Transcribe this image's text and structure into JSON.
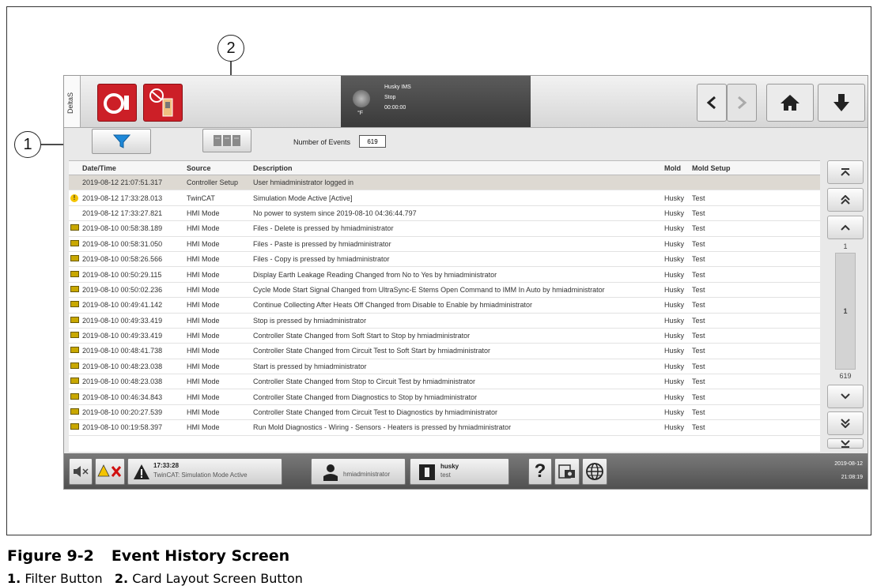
{
  "callouts": {
    "one": "1",
    "two": "2"
  },
  "header": {
    "side_tab": "DeltaS",
    "status_lines": [
      "Husky IMS",
      "Stop",
      "00:00:00"
    ],
    "temp_unit": "°F"
  },
  "toolbar": {
    "events_label": "Number of Events",
    "events_count": "619"
  },
  "table": {
    "columns": [
      "Date/Time",
      "Source",
      "Description",
      "Mold",
      "Mold Setup"
    ],
    "rows": [
      {
        "icon": "none",
        "dt": "2019-08-12 21:07:51.317",
        "src": "Controller Setup",
        "desc": "User hmiadministrator logged in",
        "mold": "",
        "setup": ""
      },
      {
        "icon": "warning-icon",
        "dt": "2019-08-12 17:33:28.013",
        "src": "TwinCAT",
        "desc": "Simulation Mode Active [Active]",
        "mold": "Husky",
        "setup": "Test"
      },
      {
        "icon": "none",
        "dt": "2019-08-12 17:33:27.821",
        "src": "HMI Mode",
        "desc": "No power to system since 2019-08-10 04:36:44.797",
        "mold": "Husky",
        "setup": "Test"
      },
      {
        "icon": "mode-icon",
        "dt": "2019-08-10 00:58:38.189",
        "src": "HMI Mode",
        "desc": "Files - Delete is pressed by hmiadministrator",
        "mold": "Husky",
        "setup": "Test"
      },
      {
        "icon": "mode-icon",
        "dt": "2019-08-10 00:58:31.050",
        "src": "HMI Mode",
        "desc": "Files - Paste is pressed by hmiadministrator",
        "mold": "Husky",
        "setup": "Test"
      },
      {
        "icon": "mode-icon",
        "dt": "2019-08-10 00:58:26.566",
        "src": "HMI Mode",
        "desc": "Files - Copy is pressed by hmiadministrator",
        "mold": "Husky",
        "setup": "Test"
      },
      {
        "icon": "mode-icon",
        "dt": "2019-08-10 00:50:29.115",
        "src": "HMI Mode",
        "desc": "Display Earth Leakage Reading Changed from No to Yes  by hmiadministrator",
        "mold": "Husky",
        "setup": "Test"
      },
      {
        "icon": "mode-icon",
        "dt": "2019-08-10 00:50:02.236",
        "src": "HMI Mode",
        "desc": "Cycle Mode Start Signal Changed from UltraSync-E Stems Open Command to IMM In Auto  by hmiadministrator",
        "mold": "Husky",
        "setup": "Test"
      },
      {
        "icon": "mode-icon",
        "dt": "2019-08-10 00:49:41.142",
        "src": "HMI Mode",
        "desc": "Continue Collecting After Heats Off Changed from Disable to Enable  by hmiadministrator",
        "mold": "Husky",
        "setup": "Test"
      },
      {
        "icon": "mode-icon",
        "dt": "2019-08-10 00:49:33.419",
        "src": "HMI Mode",
        "desc": "Stop is pressed by hmiadministrator",
        "mold": "Husky",
        "setup": "Test"
      },
      {
        "icon": "mode-icon",
        "dt": "2019-08-10 00:49:33.419",
        "src": "HMI Mode",
        "desc": "Controller State Changed from Soft Start to Stop  by hmiadministrator",
        "mold": "Husky",
        "setup": "Test"
      },
      {
        "icon": "mode-icon",
        "dt": "2019-08-10 00:48:41.738",
        "src": "HMI Mode",
        "desc": "Controller State Changed from Circuit Test to Soft Start  by hmiadministrator",
        "mold": "Husky",
        "setup": "Test"
      },
      {
        "icon": "mode-icon",
        "dt": "2019-08-10 00:48:23.038",
        "src": "HMI Mode",
        "desc": "Start is pressed by hmiadministrator",
        "mold": "Husky",
        "setup": "Test"
      },
      {
        "icon": "mode-icon",
        "dt": "2019-08-10 00:48:23.038",
        "src": "HMI Mode",
        "desc": "Controller State Changed from Stop to Circuit Test  by hmiadministrator",
        "mold": "Husky",
        "setup": "Test"
      },
      {
        "icon": "mode-icon",
        "dt": "2019-08-10 00:46:34.843",
        "src": "HMI Mode",
        "desc": "Controller State Changed from Diagnostics to Stop  by hmiadministrator",
        "mold": "Husky",
        "setup": "Test"
      },
      {
        "icon": "mode-icon",
        "dt": "2019-08-10 00:20:27.539",
        "src": "HMI Mode",
        "desc": "Controller State Changed from Circuit Test to Diagnostics  by hmiadministrator",
        "mold": "Husky",
        "setup": "Test"
      },
      {
        "icon": "mode-icon",
        "dt": "2019-08-10 00:19:58.397",
        "src": "HMI Mode",
        "desc": "Run Mold Diagnostics - Wiring - Sensors - Heaters is pressed by hmiadministrator",
        "mold": "Husky",
        "setup": "Test"
      }
    ]
  },
  "pager": {
    "top": "1",
    "current": "1",
    "bottom": "619"
  },
  "bottom_bar": {
    "alarm_time": "17:33:28",
    "alarm_text": "TwinCAT: Simulation Mode Active",
    "user": "hmiadministrator",
    "mold_name": "husky",
    "mold_setup": "test",
    "help": "?",
    "date": "2019-08-12",
    "time": "21:08:19"
  },
  "caption": {
    "figure_label": "Figure 9-2",
    "figure_title": "Event History Screen",
    "items": [
      {
        "num": "1.",
        "text": "Filter Button"
      },
      {
        "num": "2.",
        "text": "Card Layout Screen Button"
      }
    ]
  }
}
